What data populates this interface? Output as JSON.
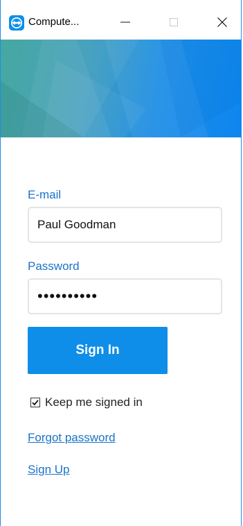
{
  "window": {
    "title": "Compute...",
    "minimize_icon": "minimize-icon",
    "maximize_icon": "maximize-icon",
    "close_icon": "close-icon"
  },
  "colors": {
    "accent": "#0e8ee9",
    "label": "#1a73c9"
  },
  "form": {
    "email_label": "E-mail",
    "email_value": "Paul Goodman",
    "password_label": "Password",
    "password_value": "••••••••••",
    "sign_in_label": "Sign In",
    "keep_signed_in_label": "Keep me signed in",
    "keep_signed_in_checked": true,
    "forgot_password_label": "Forgot password",
    "sign_up_label": "Sign Up"
  }
}
